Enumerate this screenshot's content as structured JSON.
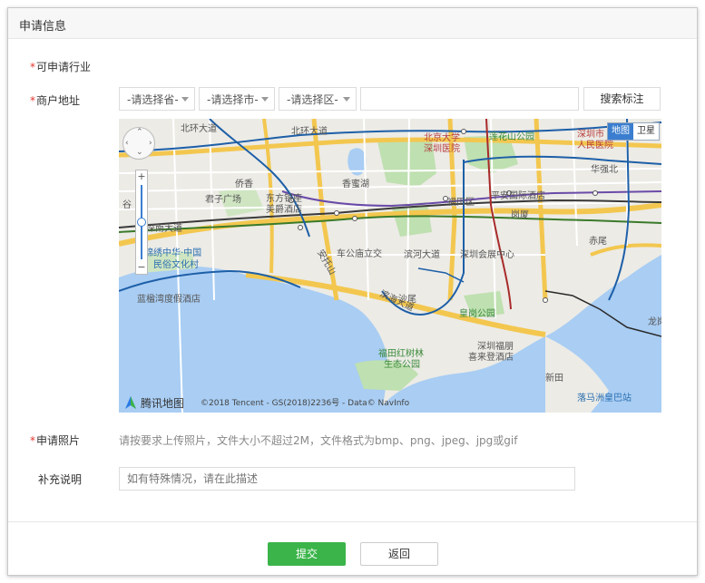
{
  "panel": {
    "title": "申请信息"
  },
  "form": {
    "required_mark": "*",
    "industry_label": "可申请行业",
    "address_label": "商户地址",
    "province_select": "-请选择省-",
    "city_select": "-请选择市-",
    "district_select": "-请选择区-",
    "address_input_value": "",
    "search_button": "搜索标注",
    "photo_label": "申请照片",
    "photo_hint": "请按要求上传照片，文件大小不超过2M，文件格式为bmp、png、jpeg、jpg或gif",
    "note_label": "补充说明",
    "note_placeholder": "如有特殊情况，请在此描述"
  },
  "map": {
    "type_map": "地图",
    "type_satellite": "卫星",
    "brand": "腾讯地图",
    "copyright": "©2018 Tencent - GS(2018)2236号 - Data© NavInfo",
    "zoom_in": "+",
    "zoom_out": "−",
    "zoom_level": 0.5,
    "labels": {
      "l1": "北环大道",
      "l2": "北环大道",
      "l3": "北京大学",
      "l4": "深圳医院",
      "l5": "莲花山公园",
      "l6": "深圳市",
      "l7": "人民医院",
      "l8": "华强北",
      "l9": "香蜜湖",
      "l10": "君子广场",
      "l11": "东方银座",
      "l12": "美爵酒店",
      "l13": "福田区",
      "l14": "平安国际酒店",
      "l15": "岗厦",
      "l16": "深南大道",
      "l17": "锦绣中华·中国",
      "l18": "民俗文化村",
      "l19": "车公庙立交",
      "l20": "滨河大道",
      "l21": "深圳会展中心",
      "l22": "赤尾",
      "l23": "蓝楹湾度假酒店",
      "l24": "沙尾",
      "l25": "皇岗公园",
      "l26": "福田红树林",
      "l27": "生态公园",
      "l28": "深圳福朋",
      "l29": "喜来登酒店",
      "l30": "新田",
      "l31": "落马洲皇巴站",
      "l32": "龙岗",
      "l33": "侨香",
      "l34": "谷",
      "l35": "滨海大道",
      "l36": "安托山"
    }
  },
  "actions": {
    "submit": "提交",
    "back": "返回"
  },
  "colors": {
    "accent": "#3bb44a",
    "required": "#e2362e",
    "water": "#a9cdf3",
    "park": "#bfe0b0"
  }
}
